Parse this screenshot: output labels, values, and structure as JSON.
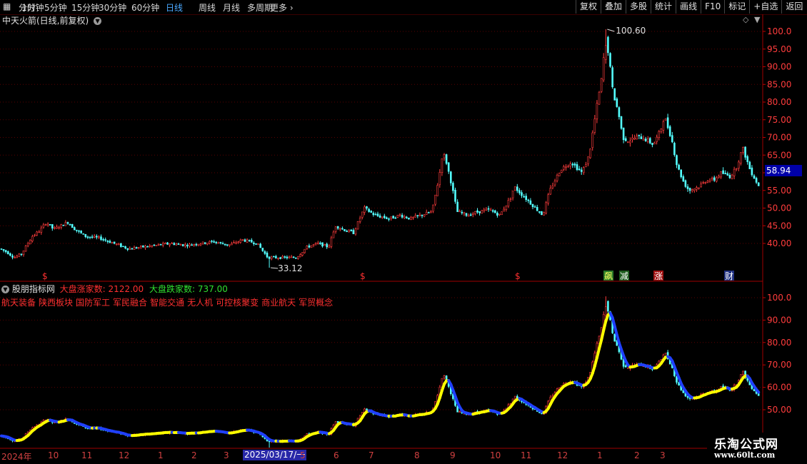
{
  "toolbar": {
    "periods": [
      "分时",
      "1分钟",
      "5分钟",
      "15分钟",
      "30分钟",
      "60分钟",
      "日线",
      "周线",
      "月线",
      "多周期",
      "更多"
    ],
    "active": "日线",
    "buttons": [
      "复权",
      "叠加",
      "多股",
      "统计",
      "画线",
      "F10",
      "标记",
      "+自选",
      "返回"
    ]
  },
  "title": "中天火箭(日线,前复权)",
  "price_tag": "58.94",
  "high_label": "100.60",
  "low_label": "33.12",
  "event_markers": [
    "$",
    "$",
    "$",
    "飙",
    "减",
    "涨",
    "财"
  ],
  "indicator": {
    "name": "股朋指标网",
    "up_label": "大盘涨家数:",
    "up_value": "2122.00",
    "down_label": "大盘跌家数:",
    "down_value": "737.00"
  },
  "concepts": [
    "航天装备",
    "陕西板块",
    "国防军工",
    "军民融合",
    "智能交通",
    "无人机",
    "可控核聚变",
    "商业航天",
    "军贸概念"
  ],
  "x_axis": {
    "labels": [
      "2024年",
      "10",
      "11",
      "12",
      "1",
      "2",
      "3",
      "2025/03/17/一",
      "5",
      "6",
      "7",
      "8",
      "9",
      "10",
      "11",
      "12",
      "1",
      "2",
      "3"
    ]
  },
  "watermark": {
    "title": "乐淘公式网",
    "url": "www.60lt.com"
  },
  "colors": {
    "up": "#ff3c3c",
    "down": "#54ffff",
    "grid": "#5a0000",
    "ma_rise": "#ffff00",
    "ma_fall": "#2040ff",
    "select": "#2828a8"
  },
  "chart_data": {
    "type": "candlestick",
    "main_y_ticks": [
      "100.0",
      "95.00",
      "90.00",
      "85.00",
      "80.00",
      "75.00",
      "70.00",
      "65.00",
      "60.00",
      "55.00",
      "50.00",
      "45.00",
      "40.00"
    ],
    "sub_y_ticks": [
      "100.0",
      "90.00",
      "80.00",
      "70.00",
      "60.00",
      "50.00"
    ],
    "main_ylim": [
      36,
      103
    ],
    "sub_ylim": [
      43,
      104
    ],
    "keypoints": [
      [
        0,
        38.5
      ],
      [
        10,
        37.5
      ],
      [
        20,
        36
      ],
      [
        30,
        37
      ],
      [
        45,
        42
      ],
      [
        55,
        43.5
      ],
      [
        65,
        46
      ],
      [
        75,
        44
      ],
      [
        85,
        45
      ],
      [
        95,
        46
      ],
      [
        105,
        44
      ],
      [
        120,
        42
      ],
      [
        140,
        41.5
      ],
      [
        160,
        40
      ],
      [
        180,
        38.5
      ],
      [
        200,
        39
      ],
      [
        220,
        39.5
      ],
      [
        240,
        40
      ],
      [
        260,
        39.5
      ],
      [
        280,
        40
      ],
      [
        300,
        40.5
      ],
      [
        320,
        39.5
      ],
      [
        340,
        41
      ],
      [
        360,
        40
      ],
      [
        375,
        36
      ],
      [
        395,
        36
      ],
      [
        415,
        36
      ],
      [
        430,
        39
      ],
      [
        445,
        40
      ],
      [
        460,
        39
      ],
      [
        470,
        45
      ],
      [
        480,
        44
      ],
      [
        495,
        43
      ],
      [
        510,
        50
      ],
      [
        525,
        48
      ],
      [
        545,
        47
      ],
      [
        560,
        48
      ],
      [
        575,
        47
      ],
      [
        590,
        48
      ],
      [
        605,
        49
      ],
      [
        610,
        54
      ],
      [
        615,
        59
      ],
      [
        620,
        66
      ],
      [
        625,
        63
      ],
      [
        632,
        57
      ],
      [
        640,
        49
      ],
      [
        655,
        48
      ],
      [
        670,
        49
      ],
      [
        685,
        49.5
      ],
      [
        700,
        48
      ],
      [
        715,
        53
      ],
      [
        720,
        56
      ],
      [
        735,
        53
      ],
      [
        745,
        51
      ],
      [
        760,
        48
      ],
      [
        770,
        55
      ],
      [
        785,
        61
      ],
      [
        800,
        63
      ],
      [
        815,
        60
      ],
      [
        825,
        65
      ],
      [
        835,
        78
      ],
      [
        842,
        86
      ],
      [
        848,
        98
      ],
      [
        852,
        94
      ],
      [
        858,
        83
      ],
      [
        866,
        77
      ],
      [
        872,
        70
      ],
      [
        880,
        69
      ],
      [
        890,
        70
      ],
      [
        900,
        70
      ],
      [
        915,
        68
      ],
      [
        925,
        72
      ],
      [
        930,
        76
      ],
      [
        940,
        70
      ],
      [
        948,
        62
      ],
      [
        958,
        57
      ],
      [
        965,
        55
      ],
      [
        978,
        56
      ],
      [
        990,
        58
      ],
      [
        1000,
        58
      ],
      [
        1010,
        60
      ],
      [
        1022,
        59
      ],
      [
        1030,
        61
      ],
      [
        1040,
        67
      ],
      [
        1050,
        61
      ],
      [
        1063,
        56
      ]
    ]
  }
}
